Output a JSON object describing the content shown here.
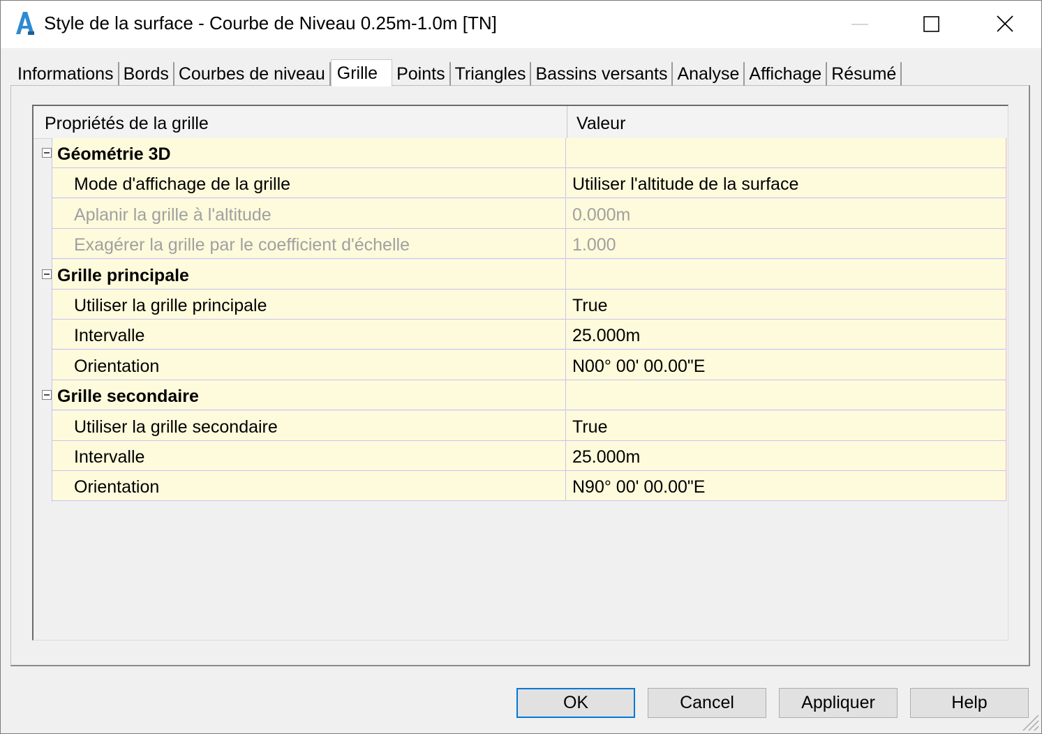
{
  "window": {
    "title": "Style de la surface - Courbe de Niveau 0.25m-1.0m [TN]",
    "icon": "autocad-a-icon",
    "controls": [
      "minimize-icon",
      "maximize-icon",
      "close-icon"
    ]
  },
  "tabs": [
    {
      "label": "Informations",
      "active": false
    },
    {
      "label": "Bords",
      "active": false
    },
    {
      "label": "Courbes de niveau",
      "active": false
    },
    {
      "label": "Grille",
      "active": true
    },
    {
      "label": "Points",
      "active": false
    },
    {
      "label": "Triangles",
      "active": false
    },
    {
      "label": "Bassins versants",
      "active": false
    },
    {
      "label": "Analyse",
      "active": false
    },
    {
      "label": "Affichage",
      "active": false
    },
    {
      "label": "Résumé",
      "active": false
    }
  ],
  "grid": {
    "headers": {
      "property": "Propriétés de la grille",
      "value": "Valeur"
    },
    "categories": [
      {
        "label": "Géométrie 3D",
        "rows": [
          {
            "label": "Mode d'affichage de la grille",
            "value": "Utiliser l'altitude de la surface",
            "disabled": false
          },
          {
            "label": "Aplanir la grille à l'altitude",
            "value": "0.000m",
            "disabled": true
          },
          {
            "label": "Exagérer la grille par le coefficient d'échelle",
            "value": "1.000",
            "disabled": true
          }
        ]
      },
      {
        "label": "Grille principale",
        "rows": [
          {
            "label": "Utiliser la grille principale",
            "value": "True",
            "disabled": false
          },
          {
            "label": "Intervalle",
            "value": "25.000m",
            "disabled": false
          },
          {
            "label": "Orientation",
            "value": "N00° 00' 00.00\"E",
            "disabled": false
          }
        ]
      },
      {
        "label": "Grille secondaire",
        "rows": [
          {
            "label": "Utiliser la grille secondaire",
            "value": "True",
            "disabled": false
          },
          {
            "label": "Intervalle",
            "value": "25.000m",
            "disabled": false
          },
          {
            "label": "Orientation",
            "value": "N90° 00' 00.00\"E",
            "disabled": false
          }
        ]
      }
    ]
  },
  "buttons": {
    "ok": "OK",
    "cancel": "Cancel",
    "apply": "Appliquer",
    "help": "Help"
  },
  "colors": {
    "row_background": "#fefbdc",
    "row_border": "#c8c1f0",
    "default_button_border": "#0078d7",
    "disabled_text": "#a0a0a0"
  }
}
